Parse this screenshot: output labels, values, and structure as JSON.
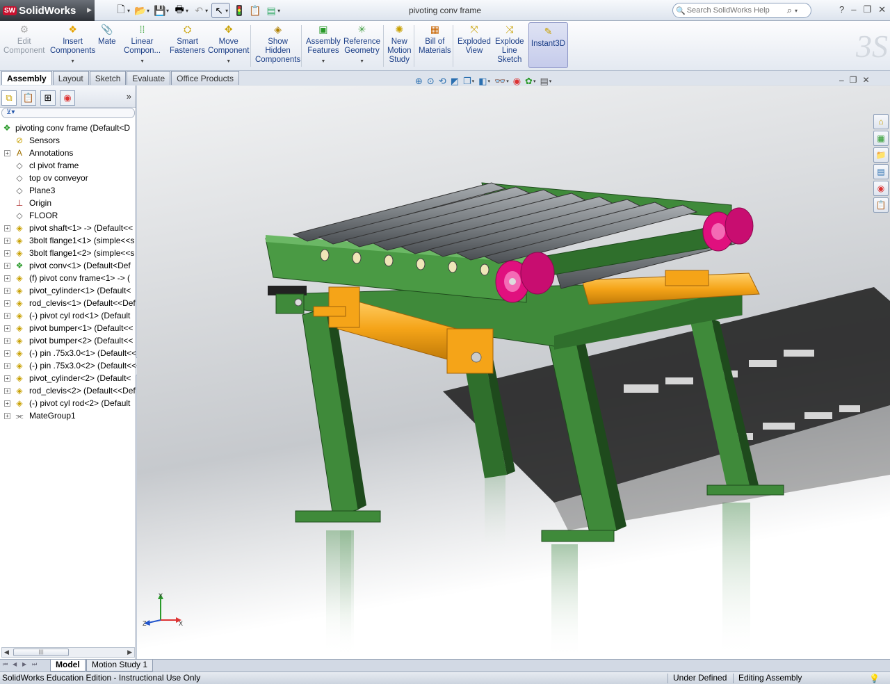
{
  "app": {
    "name": "SolidWorks",
    "doc_title": "pivoting conv frame"
  },
  "quick_access": [
    {
      "name": "new",
      "icon": "new-doc-icon"
    },
    {
      "name": "open",
      "icon": "open-folder-icon"
    },
    {
      "name": "save",
      "icon": "save-icon"
    },
    {
      "name": "print",
      "icon": "print-icon"
    },
    {
      "name": "undo",
      "icon": "undo-icon"
    },
    {
      "name": "select",
      "icon": "pointer-icon"
    },
    {
      "name": "rebuild",
      "icon": "rebuild-icon"
    },
    {
      "name": "options",
      "icon": "options-icon"
    }
  ],
  "help_search": {
    "placeholder": "Search SolidWorks Help"
  },
  "ribbon": {
    "edit_component": {
      "line1": "Edit",
      "line2": "Component"
    },
    "insert_components": {
      "line1": "Insert",
      "line2": "Components"
    },
    "mate": {
      "line1": "Mate"
    },
    "linear_component": {
      "line1": "Linear",
      "line2": "Compon..."
    },
    "smart_fasteners": {
      "line1": "Smart",
      "line2": "Fasteners"
    },
    "move_component": {
      "line1": "Move",
      "line2": "Component"
    },
    "show_hidden": {
      "line1": "Show",
      "line2": "Hidden",
      "line3": "Components"
    },
    "assembly_features": {
      "line1": "Assembly",
      "line2": "Features"
    },
    "reference_geometry": {
      "line1": "Reference",
      "line2": "Geometry"
    },
    "new_motion_study": {
      "line1": "New",
      "line2": "Motion",
      "line3": "Study"
    },
    "bill_of_materials": {
      "line1": "Bill of",
      "line2": "Materials"
    },
    "exploded_view": {
      "line1": "Exploded",
      "line2": "View"
    },
    "explode_line_sketch": {
      "line1": "Explode",
      "line2": "Line",
      "line3": "Sketch"
    },
    "instant3d": {
      "line1": "Instant3D"
    }
  },
  "command_tabs": [
    "Assembly",
    "Layout",
    "Sketch",
    "Evaluate",
    "Office Products"
  ],
  "tree": {
    "root": "pivoting conv frame  (Default<D",
    "items": [
      {
        "label": "Sensors",
        "icon": "sensor-icon",
        "expandable": false
      },
      {
        "label": "Annotations",
        "icon": "annotation-icon",
        "expandable": true
      },
      {
        "label": "cl pivot frame",
        "icon": "plane-icon",
        "expandable": false
      },
      {
        "label": "top ov conveyor",
        "icon": "plane-icon",
        "expandable": false
      },
      {
        "label": "Plane3",
        "icon": "plane-icon",
        "expandable": false
      },
      {
        "label": "Origin",
        "icon": "origin-icon",
        "expandable": false
      },
      {
        "label": "FLOOR",
        "icon": "plane-icon",
        "expandable": false
      },
      {
        "label": "pivot shaft<1> -> (Default<<",
        "icon": "part-icon",
        "expandable": true
      },
      {
        "label": "3bolt flange1<1> (simple<<s",
        "icon": "part-icon",
        "expandable": true
      },
      {
        "label": "3bolt flange1<2> (simple<<s",
        "icon": "part-icon",
        "expandable": true
      },
      {
        "label": "pivot conv<1> (Default<Def",
        "icon": "assembly-icon",
        "expandable": true
      },
      {
        "label": "(f) pivot conv frame<1> -> (",
        "icon": "part-icon",
        "expandable": true
      },
      {
        "label": "pivot_cylinder<1> (Default<",
        "icon": "part-icon",
        "expandable": true
      },
      {
        "label": "rod_clevis<1> (Default<<Def",
        "icon": "part-icon",
        "expandable": true
      },
      {
        "label": "(-) pivot cyl rod<1> (Default",
        "icon": "part-icon",
        "expandable": true
      },
      {
        "label": "pivot bumper<1> (Default<<",
        "icon": "part-icon",
        "expandable": true
      },
      {
        "label": "pivot bumper<2> (Default<<",
        "icon": "part-icon",
        "expandable": true
      },
      {
        "label": "(-) pin .75x3.0<1> (Default<<",
        "icon": "part-icon",
        "expandable": true
      },
      {
        "label": "(-) pin .75x3.0<2> (Default<<",
        "icon": "part-icon",
        "expandable": true
      },
      {
        "label": "pivot_cylinder<2> (Default<",
        "icon": "part-icon",
        "expandable": true
      },
      {
        "label": "rod_clevis<2> (Default<<Def",
        "icon": "part-icon",
        "expandable": true
      },
      {
        "label": "(-) pivot cyl rod<2> (Default",
        "icon": "part-icon",
        "expandable": true
      },
      {
        "label": "MateGroup1",
        "icon": "mategroup-icon",
        "expandable": true
      }
    ]
  },
  "bottom_tabs": [
    "Model",
    "Motion Study 1"
  ],
  "status": {
    "left": "SolidWorks Education Edition - Instructional Use Only",
    "mid": "Under Defined",
    "right": "Editing Assembly"
  },
  "colors": {
    "frame_green": "#3f8a3a",
    "roller_gray": "#7c8185",
    "flange_magenta": "#e0107e",
    "cylinder_orange": "#f5a418"
  },
  "triad": {
    "x": "X",
    "y": "Y",
    "z": "Z"
  }
}
